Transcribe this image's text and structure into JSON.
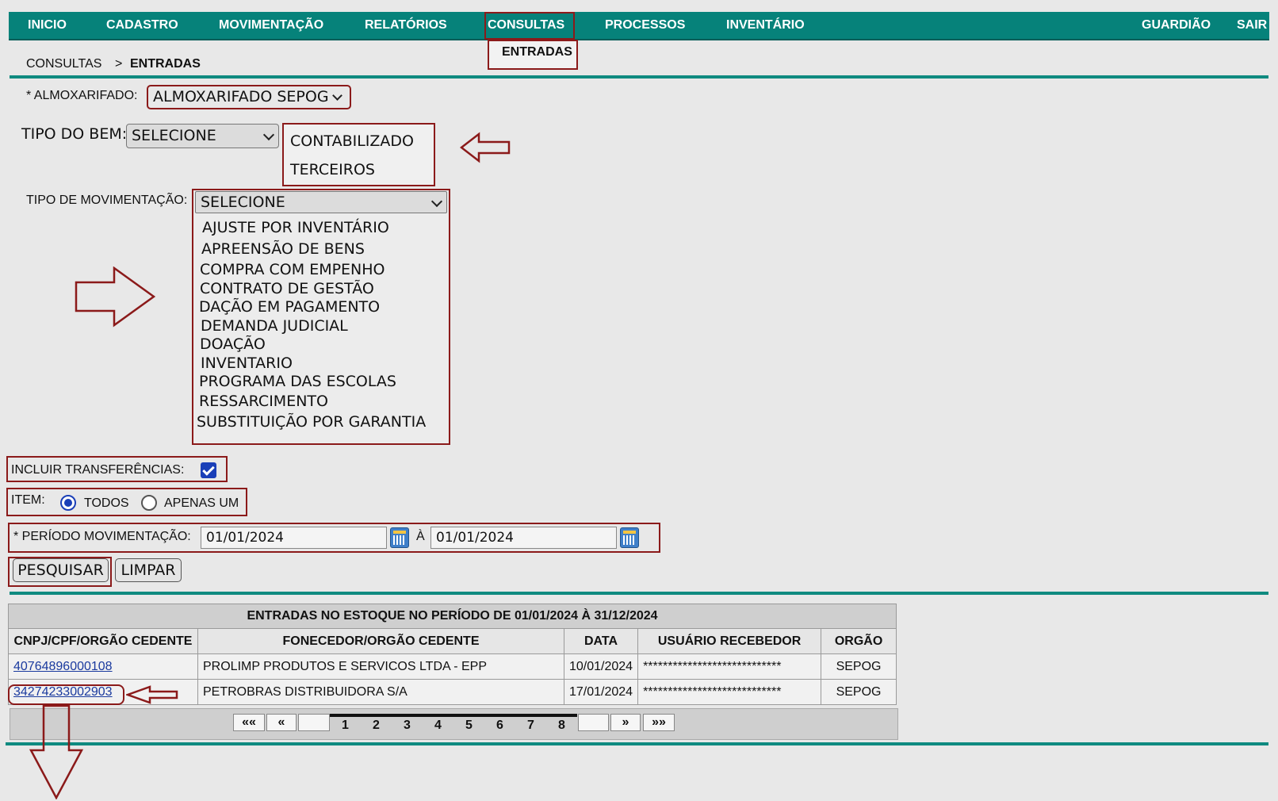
{
  "nav": {
    "items": [
      "INICIO",
      "CADASTRO",
      "MOVIMENTAÇÃO",
      "RELATÓRIOS",
      "CONSULTAS",
      "PROCESSOS",
      "INVENTÁRIO"
    ],
    "right_items": [
      "GUARDIÃO",
      "SAIR"
    ],
    "active": "CONSULTAS",
    "submenu_item": "ENTRADAS"
  },
  "breadcrumb": {
    "parent": "CONSULTAS",
    "separator": ">",
    "current": "ENTRADAS"
  },
  "form": {
    "almoxarifado": {
      "label": "* ALMOXARIFADO:",
      "value": "ALMOXARIFADO SEPOG"
    },
    "tipo_bem": {
      "label": "TIPO DO BEM:",
      "value": "SELECIONE",
      "options": [
        "CONTABILIZADO",
        "TERCEIROS"
      ]
    },
    "tipo_movimentacao": {
      "label": "TIPO DE MOVIMENTAÇÃO:",
      "value": "SELECIONE",
      "options": [
        "AJUSTE POR INVENTÁRIO",
        "APREENSÃO DE BENS",
        "COMPRA COM EMPENHO",
        "CONTRATO DE GESTÃO",
        "DAÇÃO EM PAGAMENTO",
        "DEMANDA JUDICIAL",
        "DOAÇÃO",
        "INVENTARIO",
        "PROGRAMA DAS ESCOLAS",
        "RESSARCIMENTO",
        "SUBSTITUIÇÃO POR GARANTIA"
      ]
    },
    "incluir_transferencias": {
      "label": "INCLUIR TRANSFERÊNCIAS:",
      "checked": true
    },
    "item": {
      "label": "ITEM:",
      "options": [
        "TODOS",
        "APENAS UM"
      ],
      "selected": "TODOS"
    },
    "periodo": {
      "label": "* PERÍODO MOVIMENTAÇÃO:",
      "from": "01/01/2024",
      "separator": "À",
      "to": "01/01/2024"
    },
    "buttons": {
      "search": "PESQUISAR",
      "clear": "LIMPAR"
    }
  },
  "results": {
    "caption": "ENTRADAS NO ESTOQUE NO PERÍODO DE 01/01/2024 À 31/12/2024",
    "headers": [
      "CNPJ/CPF/ORGÃO CEDENTE",
      "FONECEDOR/ORGÃO CEDENTE",
      "DATA",
      "USUÁRIO RECEBEDOR",
      "ORGÃO"
    ],
    "rows": [
      [
        "40764896000108",
        "PROLIMP PRODUTOS E SERVICOS LTDA - EPP",
        "10/01/2024",
        "****************************",
        "SEPOG"
      ],
      [
        "34274233002903",
        "PETROBRAS DISTRIBUIDORA S/A",
        "17/01/2024",
        "****************************",
        "SEPOG"
      ]
    ]
  },
  "pagination": {
    "first": "««",
    "prev": "«",
    "pages": [
      "1",
      "2",
      "3",
      "4",
      "5",
      "6",
      "7",
      "8"
    ],
    "next": "»",
    "last": "»»"
  },
  "colors": {
    "nav_bg": "#06827a",
    "annotation_red": "#8b1a1a",
    "link": "#1a3a9e",
    "checkbox": "#1a3fb8"
  }
}
